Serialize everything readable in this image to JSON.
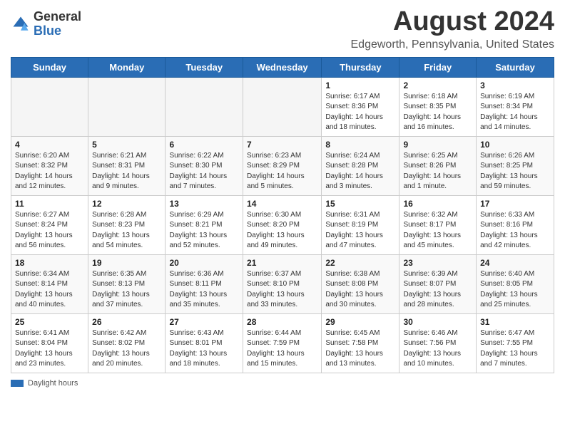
{
  "header": {
    "logo_general": "General",
    "logo_blue": "Blue",
    "main_title": "August 2024",
    "subtitle": "Edgeworth, Pennsylvania, United States"
  },
  "days_of_week": [
    "Sunday",
    "Monday",
    "Tuesday",
    "Wednesday",
    "Thursday",
    "Friday",
    "Saturday"
  ],
  "weeks": [
    [
      {
        "day": "",
        "info": ""
      },
      {
        "day": "",
        "info": ""
      },
      {
        "day": "",
        "info": ""
      },
      {
        "day": "",
        "info": ""
      },
      {
        "day": "1",
        "info": "Sunrise: 6:17 AM\nSunset: 8:36 PM\nDaylight: 14 hours\nand 18 minutes."
      },
      {
        "day": "2",
        "info": "Sunrise: 6:18 AM\nSunset: 8:35 PM\nDaylight: 14 hours\nand 16 minutes."
      },
      {
        "day": "3",
        "info": "Sunrise: 6:19 AM\nSunset: 8:34 PM\nDaylight: 14 hours\nand 14 minutes."
      }
    ],
    [
      {
        "day": "4",
        "info": "Sunrise: 6:20 AM\nSunset: 8:32 PM\nDaylight: 14 hours\nand 12 minutes."
      },
      {
        "day": "5",
        "info": "Sunrise: 6:21 AM\nSunset: 8:31 PM\nDaylight: 14 hours\nand 9 minutes."
      },
      {
        "day": "6",
        "info": "Sunrise: 6:22 AM\nSunset: 8:30 PM\nDaylight: 14 hours\nand 7 minutes."
      },
      {
        "day": "7",
        "info": "Sunrise: 6:23 AM\nSunset: 8:29 PM\nDaylight: 14 hours\nand 5 minutes."
      },
      {
        "day": "8",
        "info": "Sunrise: 6:24 AM\nSunset: 8:28 PM\nDaylight: 14 hours\nand 3 minutes."
      },
      {
        "day": "9",
        "info": "Sunrise: 6:25 AM\nSunset: 8:26 PM\nDaylight: 14 hours\nand 1 minute."
      },
      {
        "day": "10",
        "info": "Sunrise: 6:26 AM\nSunset: 8:25 PM\nDaylight: 13 hours\nand 59 minutes."
      }
    ],
    [
      {
        "day": "11",
        "info": "Sunrise: 6:27 AM\nSunset: 8:24 PM\nDaylight: 13 hours\nand 56 minutes."
      },
      {
        "day": "12",
        "info": "Sunrise: 6:28 AM\nSunset: 8:23 PM\nDaylight: 13 hours\nand 54 minutes."
      },
      {
        "day": "13",
        "info": "Sunrise: 6:29 AM\nSunset: 8:21 PM\nDaylight: 13 hours\nand 52 minutes."
      },
      {
        "day": "14",
        "info": "Sunrise: 6:30 AM\nSunset: 8:20 PM\nDaylight: 13 hours\nand 49 minutes."
      },
      {
        "day": "15",
        "info": "Sunrise: 6:31 AM\nSunset: 8:19 PM\nDaylight: 13 hours\nand 47 minutes."
      },
      {
        "day": "16",
        "info": "Sunrise: 6:32 AM\nSunset: 8:17 PM\nDaylight: 13 hours\nand 45 minutes."
      },
      {
        "day": "17",
        "info": "Sunrise: 6:33 AM\nSunset: 8:16 PM\nDaylight: 13 hours\nand 42 minutes."
      }
    ],
    [
      {
        "day": "18",
        "info": "Sunrise: 6:34 AM\nSunset: 8:14 PM\nDaylight: 13 hours\nand 40 minutes."
      },
      {
        "day": "19",
        "info": "Sunrise: 6:35 AM\nSunset: 8:13 PM\nDaylight: 13 hours\nand 37 minutes."
      },
      {
        "day": "20",
        "info": "Sunrise: 6:36 AM\nSunset: 8:11 PM\nDaylight: 13 hours\nand 35 minutes."
      },
      {
        "day": "21",
        "info": "Sunrise: 6:37 AM\nSunset: 8:10 PM\nDaylight: 13 hours\nand 33 minutes."
      },
      {
        "day": "22",
        "info": "Sunrise: 6:38 AM\nSunset: 8:08 PM\nDaylight: 13 hours\nand 30 minutes."
      },
      {
        "day": "23",
        "info": "Sunrise: 6:39 AM\nSunset: 8:07 PM\nDaylight: 13 hours\nand 28 minutes."
      },
      {
        "day": "24",
        "info": "Sunrise: 6:40 AM\nSunset: 8:05 PM\nDaylight: 13 hours\nand 25 minutes."
      }
    ],
    [
      {
        "day": "25",
        "info": "Sunrise: 6:41 AM\nSunset: 8:04 PM\nDaylight: 13 hours\nand 23 minutes."
      },
      {
        "day": "26",
        "info": "Sunrise: 6:42 AM\nSunset: 8:02 PM\nDaylight: 13 hours\nand 20 minutes."
      },
      {
        "day": "27",
        "info": "Sunrise: 6:43 AM\nSunset: 8:01 PM\nDaylight: 13 hours\nand 18 minutes."
      },
      {
        "day": "28",
        "info": "Sunrise: 6:44 AM\nSunset: 7:59 PM\nDaylight: 13 hours\nand 15 minutes."
      },
      {
        "day": "29",
        "info": "Sunrise: 6:45 AM\nSunset: 7:58 PM\nDaylight: 13 hours\nand 13 minutes."
      },
      {
        "day": "30",
        "info": "Sunrise: 6:46 AM\nSunset: 7:56 PM\nDaylight: 13 hours\nand 10 minutes."
      },
      {
        "day": "31",
        "info": "Sunrise: 6:47 AM\nSunset: 7:55 PM\nDaylight: 13 hours\nand 7 minutes."
      }
    ]
  ],
  "footer": {
    "label": "Daylight hours"
  }
}
